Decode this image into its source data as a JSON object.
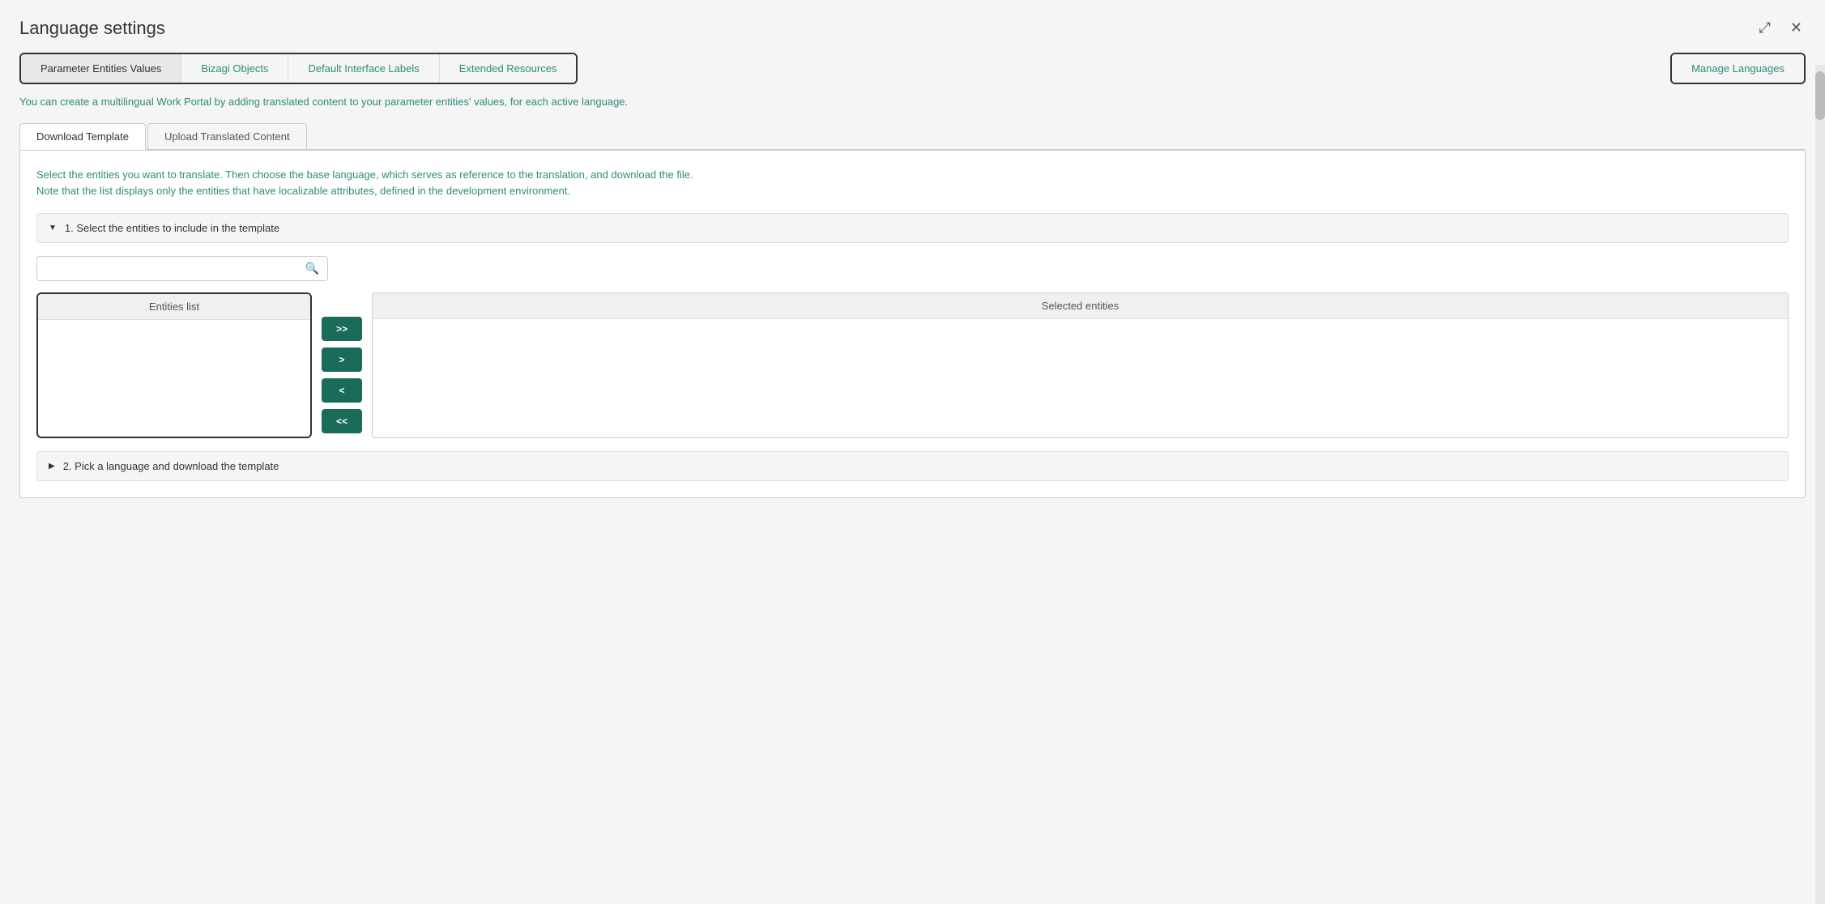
{
  "modal": {
    "title": "Language settings"
  },
  "icons": {
    "expand": "⤢",
    "close": "✕",
    "search": "🔍",
    "arrow_down": "▼",
    "arrow_right": "▶"
  },
  "top_tabs": [
    {
      "id": "param-entities",
      "label": "Parameter Entities Values",
      "active": true
    },
    {
      "id": "bizagi-objects",
      "label": "Bizagi Objects",
      "active": false
    },
    {
      "id": "default-interface",
      "label": "Default Interface Labels",
      "active": false
    },
    {
      "id": "extended-resources",
      "label": "Extended Resources",
      "active": false
    }
  ],
  "manage_languages": {
    "label": "Manage Languages"
  },
  "info_text": "You can create a multilingual Work Portal by adding translated content to your parameter entities' values, for each active language.",
  "inner_tabs": [
    {
      "id": "download-template",
      "label": "Download Template",
      "active": true
    },
    {
      "id": "upload-translated",
      "label": "Upload Translated Content",
      "active": false
    }
  ],
  "panel": {
    "description_line1": "Select the entities you want to translate. Then choose the base language, which serves as reference to the translation, and download the file.",
    "description_line2": "Note that the list displays only the entities that have localizable attributes, defined in the development environment."
  },
  "section1": {
    "label": "1. Select the entities to include in the template"
  },
  "search": {
    "placeholder": ""
  },
  "entities_list": {
    "header": "Entities list"
  },
  "transfer_buttons": [
    {
      "id": "add-all",
      "label": ">>"
    },
    {
      "id": "add-one",
      "label": ">"
    },
    {
      "id": "remove-one",
      "label": "<"
    },
    {
      "id": "remove-all",
      "label": "<<"
    }
  ],
  "selected_entities": {
    "header": "Selected entities"
  },
  "section2": {
    "label": "2. Pick a language and download the template"
  }
}
